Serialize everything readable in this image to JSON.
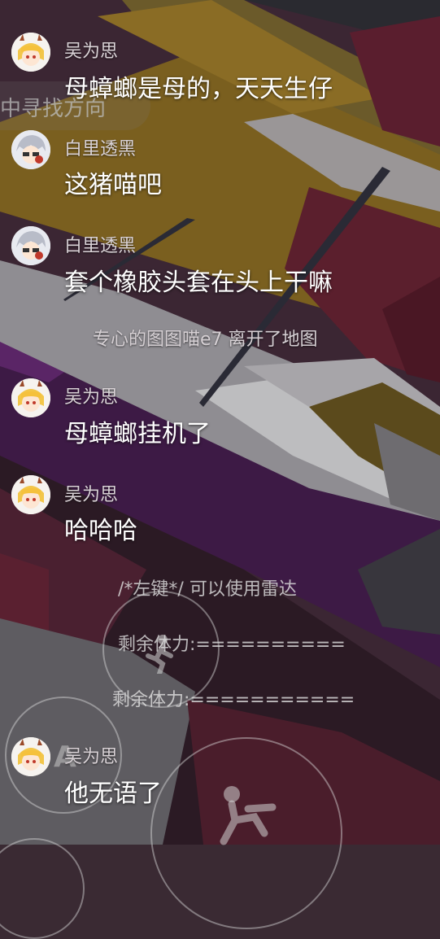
{
  "hud": {
    "ghost_text": "中寻找方向",
    "radar_hint": "/*左键*/ 可以使用雷达",
    "stamina_1": "剩余体力:==========",
    "stamina_2": "剩余体力:===========",
    "key_a": "A"
  },
  "chat": [
    {
      "user": "吴为思",
      "text": "母蟑螂是母的，天天生仔",
      "avatar": "blonde-girl-avatar"
    },
    {
      "user": "白里透黑",
      "text": "这猪喵吧",
      "avatar": "gray-hair-avatar"
    },
    {
      "user": "白里透黑",
      "text": "套个橡胶头套在头上干嘛",
      "avatar": "gray-hair-avatar"
    },
    {
      "user": "吴为思",
      "text": "母蟑螂挂机了",
      "avatar": "blonde-girl-avatar"
    },
    {
      "user": "吴为思",
      "text": "哈哈哈",
      "avatar": "blonde-girl-avatar"
    },
    {
      "user": "吴为思",
      "text": "他无语了",
      "avatar": "blonde-girl-avatar"
    }
  ],
  "system_message": "专心的图图喵e7 离开了地图"
}
